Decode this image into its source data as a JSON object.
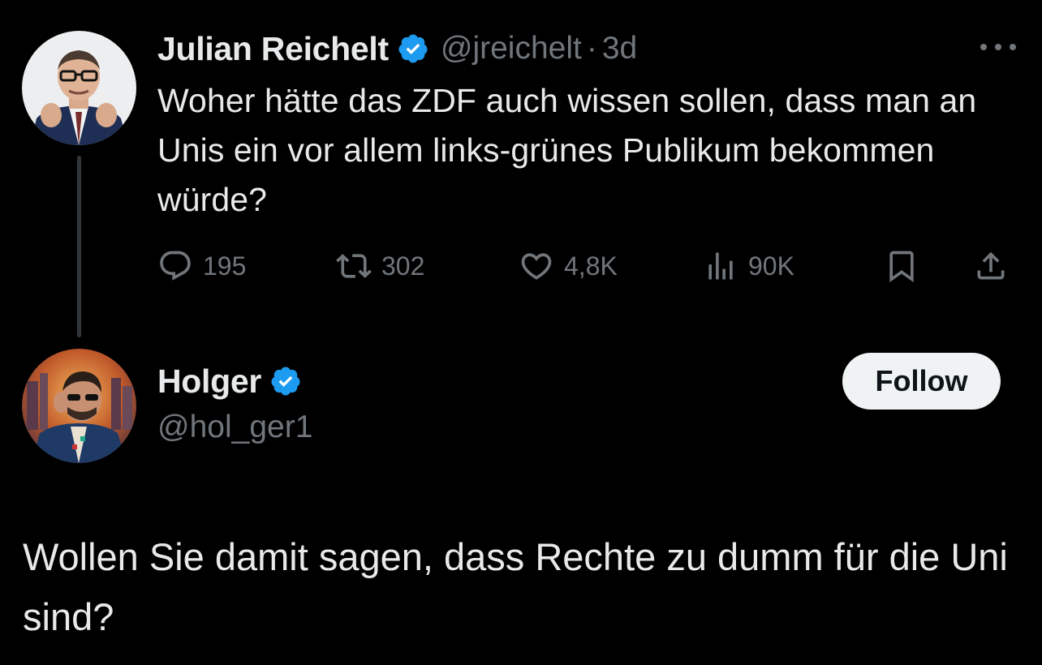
{
  "parent": {
    "author_name": "Julian Reichelt",
    "handle": "@jreichelt",
    "separator": "·",
    "time": "3d",
    "text": "Woher hätte das ZDF auch wissen sollen, dass man an Unis ein vor allem links-grünes Publikum bekommen würde?",
    "stats": {
      "replies": "195",
      "retweets": "302",
      "likes": "4,8K",
      "views": "90K"
    }
  },
  "reply": {
    "author_name": "Holger",
    "handle": "@hol_ger1",
    "follow_label": "Follow",
    "text": "Wollen Sie damit sagen, dass Rechte zu dumm für die Uni sind?"
  },
  "icons": [
    "more-icon",
    "verified-badge-icon",
    "reply-icon",
    "retweet-icon",
    "like-icon",
    "views-icon",
    "bookmark-icon",
    "share-icon"
  ],
  "colors": {
    "background": "#000000",
    "text_primary": "#e7e9ea",
    "text_secondary": "#71767b",
    "verified_blue": "#1d9bf0",
    "follow_button_bg": "#eff3f4",
    "thread_line": "#333639"
  }
}
